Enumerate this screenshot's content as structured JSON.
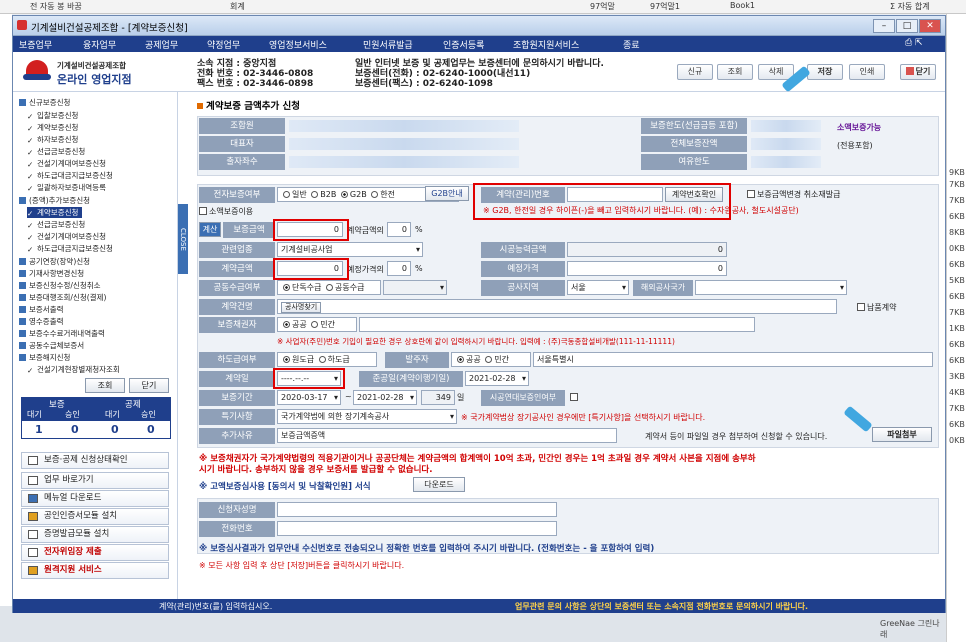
{
  "background": {
    "top_items": [
      "회계",
      "97억말",
      "97억말1",
      "Book1",
      "Σ 자동 합계",
      "전 자동 봉 바꿈"
    ],
    "right_items": [
      "9KB",
      "7KB",
      "7KB",
      "6KB",
      "8KB",
      "0KB",
      "6KB",
      "5KB",
      "6KB",
      "7KB",
      "1KB",
      "6KB",
      "6KB",
      "3KB",
      "4KB",
      "7KB",
      "6KB",
      "0KB"
    ],
    "watermark": "GreeNae 그린나래"
  },
  "window": {
    "title": "기계설비건설공제조합 - [계약보증신청]"
  },
  "menu": [
    "보증업무",
    "융자업무",
    "공제업무",
    "약정업무",
    "영업정보서비스",
    "민원서류발급",
    "인증서등록",
    "조합원지원서비스",
    "종료"
  ],
  "header": {
    "logo_line1": "기계설비건설공제조합",
    "logo_line2": "온라인 영업지점",
    "branch_line1": "소속 지점 : 중앙지점",
    "branch_line2": "전화 번호 : 02-3446-0808",
    "branch_line3": "팩스 번호 : 02-3446-0898",
    "notice_line1": "일반 인터넷 보증 및 공제업무는 보증센터에 문의하시기 바랍니다.",
    "notice_line2": "보증센터(전화) : 02-6240-1000(내선11)",
    "notice_line3": "보증센터(팩스) : 02-6240-1098",
    "btn_new": "신규",
    "btn_search": "조회",
    "btn_delete": "삭제",
    "btn_save": "저장",
    "btn_print": "인쇄",
    "btn_close": "닫기"
  },
  "sidebar": {
    "items": [
      "신규보증신청",
      "입찰보증신청",
      "계약보증신청",
      "하자보증신청",
      "선급금보증신청",
      "건설기계대여보증신청",
      "하도급대금지급보증신청",
      "일괄하자보증내역등록",
      "(증액)추가보증신청",
      "계약보증신청",
      "선급금보증신청",
      "건설기계대여보증신청",
      "하도급대금지급보증신청",
      "공기연장(장약)신청",
      "기재사항변경신청",
      "보증신청수정/신청취소",
      "보증대행조회/신청(결제)",
      "보증서출력",
      "영수증출력",
      "보증수수료거래내역출력",
      "공동수급체보증서",
      "보증해지신청",
      "건설기계현장별재청자조회"
    ],
    "search_btn": "조회",
    "close_btn": "닫기",
    "table_headers": [
      "보증",
      "공제"
    ],
    "table_sub": [
      "대기",
      "승인",
      "대기",
      "승인"
    ],
    "table_vals": [
      "1",
      "0",
      "0",
      "0"
    ],
    "links": [
      "보증·공제 신청상태확인",
      "업무 바로가기",
      "메뉴얼 다운로드",
      "공인인증서모듈 설치",
      "증명발급모듈 설치",
      "전자위임장 제출",
      "원격지원 서비스"
    ],
    "close_tab": "CLOSE"
  },
  "main": {
    "title": "계약보증 금액추가 신청",
    "info": {
      "member": "조합원",
      "rep": "대표자",
      "staff": "출자좌수",
      "limit": "보증한도(선급금등 포함)",
      "limit_val": "소액보증가능",
      "total": "전체보증잔액",
      "total_val": "(전용포함)",
      "spare": "여유한도"
    },
    "form": {
      "e_guarantee": "전자보증여부",
      "opt_general": "일반",
      "opt_b2b": "B2B",
      "opt_g2b": "G2B",
      "opt_han": "한전",
      "g2b_guide": "G2B안내",
      "contract_no": "계약(관리)번호",
      "contract_check": "계약번호확인",
      "cancel_change": "보증금액변경 취소재발급",
      "warn_g2b": "※ G2B, 한전일 경우 하이픈(-)을 빼고 입력하시기 바랍니다. (예) : 수자원공사, 철도시설공단)",
      "small_guarantee": "소액보증이용",
      "calc": "계산",
      "g_amount": "보증금액",
      "g_amount_val": "0",
      "contract_ratio": "계약금액의",
      "ratio_val": "0",
      "pct": "%",
      "industry": "관련업종",
      "industry_val": "기계설비공사업",
      "capacity": "시공능력금액",
      "capacity_val": "0",
      "c_amount": "계약금액",
      "c_amount_val": "0",
      "est_ratio": "예정가격의",
      "est_ratio_val": "0",
      "est_price": "예정가격",
      "est_price_val": "0",
      "joint": "공동수급여부",
      "opt_single": "단독수급",
      "opt_joint": "공동수급",
      "site": "공사지역",
      "site_val": "서울",
      "overseas": "해외공사국가",
      "contract_name": "계약건명",
      "contract_name_ph": "공사명찾기",
      "delivery": "납품계약",
      "obligee": "보증채권자",
      "opt_public": "공공",
      "opt_private": "민간",
      "obligee_note": "※ 사업자(주민)번호 기입이 필요한 경우 상호란에 같이 입력하시기 바랍니다. 입력예 : (주)극동종합설비개발(111-11-11111)",
      "subcontract": "하도급여부",
      "opt_prime": "원도급",
      "opt_sub": "하도급",
      "orderer": "발주자",
      "orderer_val": "서울특별시",
      "contract_date": "계약일",
      "contract_date_val": "----.--.--",
      "completion": "준공일(계약이행기일)",
      "completion_val": "2021-02-28",
      "period": "보증기간",
      "period_from": "2020-03-17",
      "period_to": "2021-02-28",
      "days": "349",
      "days_unit": "일",
      "sync": "시공연대보증인여부",
      "special": "특기사항",
      "special_val": "국가계약법에 의한 장기계속공사",
      "special_note": "※ 국가계약법상 장기공사인 경우에만 [특기사항]을 선택하시기 바랍니다.",
      "reason": "추가사유",
      "reason_val": "보증금액증액",
      "attach_note": "계약서 등이 파일일 경우 첨부하여 신청할 수 있습니다.",
      "attach_btn": "파일첨부"
    },
    "notice1": "※ 보증채권자가 국가계약법령의 적용기관이거나 공공단체는 계약금액의 합계액이 10억 초과, 민간인 경우는 1억 초과일 경우 계약서 사본을 지점에 송부하시기 바랍니다. 송부하지 않을 경우 보증서를 발급할 수 없습니다.",
    "notice2": "※ 고액보증심사용 [동의서 및 낙찰확인원] 서식",
    "download": "다운로드",
    "applicant": "신청자성명",
    "phone": "전화번호",
    "notice3": "※ 보증심사결과가 업무안내 수신번호로 전송되오니 정확한 번호를 입력하여 주시기 바랍니다. (전화번호는 - 을 포함하여 입력)",
    "notice4": "※ 모든 사항 입력 후 상단 [저장]버튼을 클릭하시기 바랍니다."
  },
  "status": {
    "left": "계약(관리)번호(를) 입력하십시오.",
    "right": "업무관련 문의 사항은 상단의 보증센터 또는 소속지점 전화번호로 문의하시기 바랍니다."
  }
}
